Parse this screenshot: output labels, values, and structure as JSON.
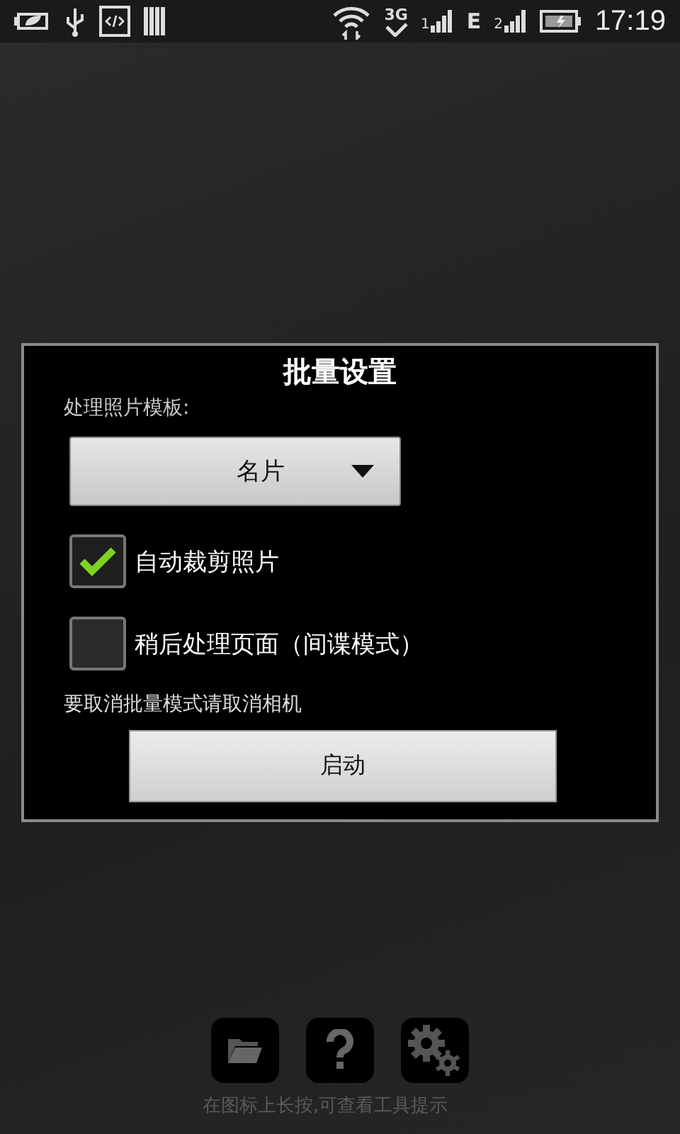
{
  "status_bar": {
    "network_3g": "3G",
    "sim1": "1",
    "network_e": "E",
    "sim2": "2",
    "time": "17:19"
  },
  "dialog": {
    "title": "批量设置",
    "template_label": "处理照片模板:",
    "template_value": "名片",
    "options": [
      {
        "label": "自动裁剪照片",
        "checked": true
      },
      {
        "label": "稍后处理页面（间谍模式）",
        "checked": false
      }
    ],
    "hint": "要取消批量模式请取消相机",
    "start_button": "启动"
  },
  "toolbar_hint": "在图标上长按,可查看工具提示"
}
